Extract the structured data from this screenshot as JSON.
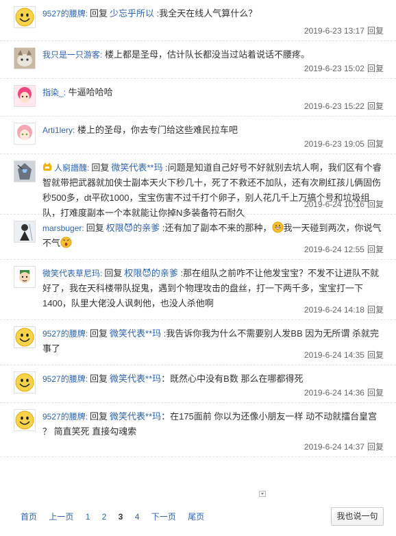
{
  "reply_word": "回复",
  "reply_link": "回复",
  "replies": [
    {
      "user": "9527的腰牌:",
      "target": "少忘乎所以",
      "text": " :我全天在线人气算什么？",
      "time": "2019-6-23 13:17",
      "avatar": "smiley-face",
      "height": 60
    },
    {
      "user": "我只是一只游客:",
      "text": " 楼上都是圣母，估计队长都没当过站着说话不腰疼。",
      "time": "2019-6-23 15:02",
      "avatar": "cat-photo",
      "height": 55
    },
    {
      "user": "指染_:",
      "text": " 牛逼哈哈哈",
      "time": "2019-6-23 15:22",
      "avatar": "pink-hair-anime",
      "height": 55
    },
    {
      "user": "Arti1lery:",
      "text": " 楼上的圣母，你去专门给这些难民拉车吧",
      "time": "2019-6-23 19:05",
      "avatar": "pink-hair-girl",
      "height": 55
    },
    {
      "user": "人窮譖醜:",
      "target": "微笑代表**玛",
      "text": " :问题是知道自己好号不好就别去坑人啊，我们区有个睿智就带把武器就加侠士副本天火下秒几十，死了不救还不加队，还有次刷红孩儿俩固伤秒500多，dt平砍1000，宝宝伤害不过千打个卵子，别人花几千上万搞个号和垃圾组队，打难度副本一个本就能让你掉N多装备符石耐久",
      "time": "2019-6-24 10:16",
      "avatar": "robot-mecha",
      "vip": true,
      "height": 88
    },
    {
      "user": "marsbuger:",
      "target": "权限😈的亲爹",
      "text": " :还有加了副本不来的那种，",
      "text2": "我一天碰到两次，你说气不气",
      "time": "2019-6-24 12:55",
      "avatar": "dark-figure",
      "emojis": [
        "grin-emoji",
        "angry-emoji"
      ],
      "height": 66
    },
    {
      "user": "微笑代表草尼玛:",
      "target": "权限😈的亲爹",
      "text": " :那在组队之前咋不让他发宝宝？不发不让进队不就好了，我在天科楼带队捉鬼，遇到个物理攻击的盘丝，打一下两千多，宝宝打一下1400，队里大佬没人讽刺他，也没人杀他啊",
      "time": "2019-6-24 14:18",
      "avatar": "cartoon-boy",
      "height": 88
    },
    {
      "user": "9527的腰牌:",
      "target": "微笑代表**玛",
      "text": " :我告诉你我为什么不需要别人发BB 因为无所谓 杀就完事了",
      "time": "2019-6-24 14:35",
      "avatar": "smiley-face",
      "height": 66
    },
    {
      "user": "9527的腰牌:",
      "target": "微笑代表**玛",
      "text": "：既然心中没有B数 那么在哪都得死",
      "time": "2019-6-24 14:36",
      "avatar": "smiley-face",
      "height": 55
    },
    {
      "user": "9527的腰牌:",
      "target": "微笑代表**玛",
      "text": "：在175面前 你以为还像小朋友一样 动不动就擂台皇宫 ？ 简直笑死 直接勾魂索",
      "time": "2019-6-24 14:37",
      "avatar": "smiley-face",
      "height": 79
    }
  ],
  "pager": {
    "first": "首页",
    "prev": "上一页",
    "pages": [
      "1",
      "2",
      "3",
      "4"
    ],
    "current": "3",
    "next": "下一页",
    "last": "尾页"
  },
  "say_button": "我也说一句",
  "colors": {
    "link": "#2d64b3",
    "text": "#333333",
    "meta": "#666666"
  }
}
